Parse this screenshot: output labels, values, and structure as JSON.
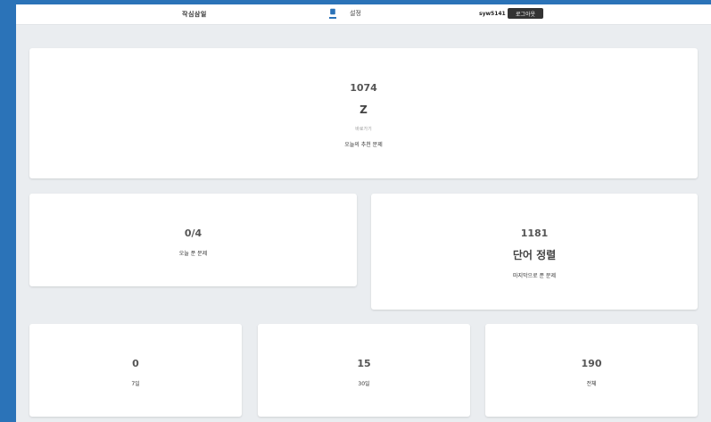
{
  "nav": {
    "brand": "작심삼일",
    "home_icon": "home-icon",
    "settings_label": "설정",
    "username": "syw5141",
    "logout_label": "로그아웃"
  },
  "colors": {
    "accent": "#2b73b8",
    "background": "#eaedf0",
    "card": "#ffffff",
    "logout_button": "#333333"
  },
  "recommended": {
    "problem_number": "1074",
    "problem_title": "Z",
    "shortcut_label": "바로가기",
    "caption": "오늘의 추천 문제"
  },
  "today_solved": {
    "value": "0/4",
    "caption": "오늘 푼 문제"
  },
  "last_solved": {
    "problem_number": "1181",
    "problem_title": "단어 정렬",
    "caption": "마지막으로 푼 문제"
  },
  "stats": [
    {
      "value": "0",
      "caption": "7일"
    },
    {
      "value": "15",
      "caption": "30일"
    },
    {
      "value": "190",
      "caption": "전체"
    }
  ]
}
